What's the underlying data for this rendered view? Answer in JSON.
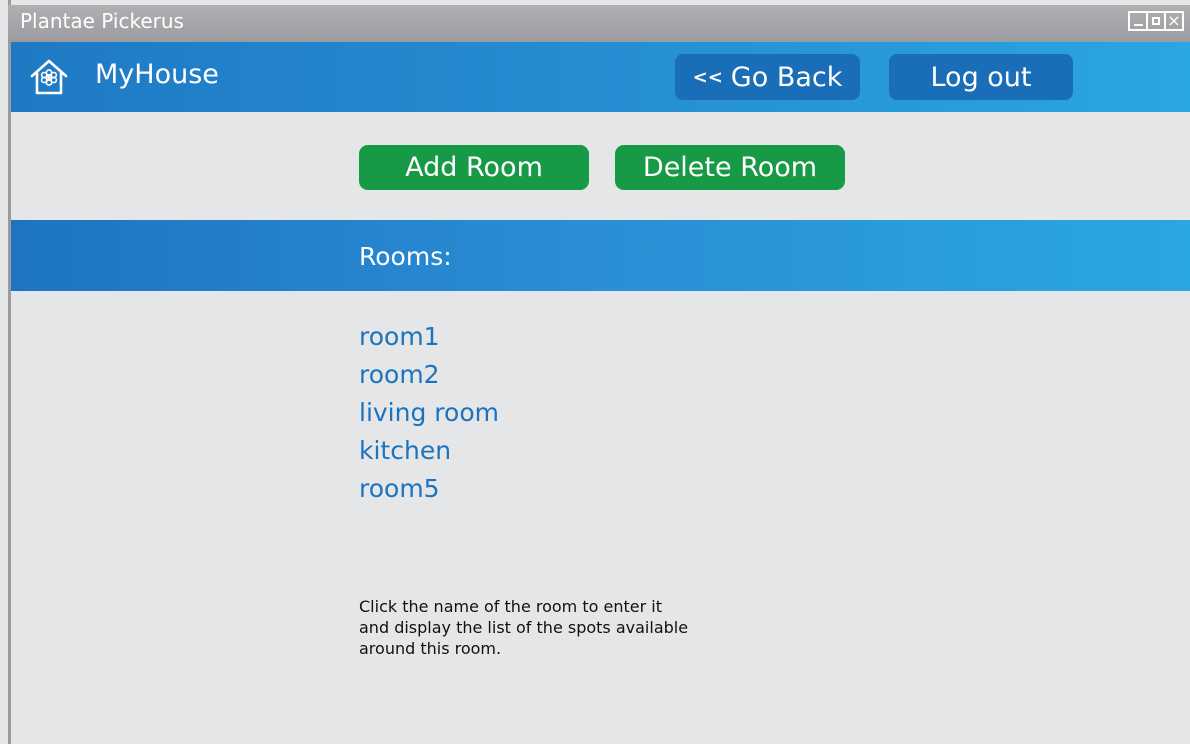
{
  "window": {
    "title": "Plantae Pickerus",
    "controls": {
      "minimize_icon": "minimize-icon",
      "maximize_icon": "maximize-icon",
      "close_icon": "close-icon",
      "close_glyph": "×"
    }
  },
  "header": {
    "app_title": "MyHouse",
    "home_icon": "house-flower-icon",
    "back_glyph": "<<",
    "back_label": "Go Back",
    "logout_label": "Log out"
  },
  "actions": {
    "add_label": "Add Room",
    "delete_label": "Delete Room"
  },
  "rooms": {
    "heading": "Rooms:",
    "items": [
      "room1",
      "room2",
      "living room",
      "kitchen",
      "room5"
    ]
  },
  "help": {
    "lines": [
      "Click the name of the room to enter it",
      "and display the list of the spots available",
      "around this room."
    ]
  },
  "colors": {
    "header_blue": "#1f79c4",
    "button_dark_blue": "#1a6db7",
    "action_green": "#169a45",
    "link_blue": "#1d73bf",
    "background": "#e5e6e8"
  }
}
